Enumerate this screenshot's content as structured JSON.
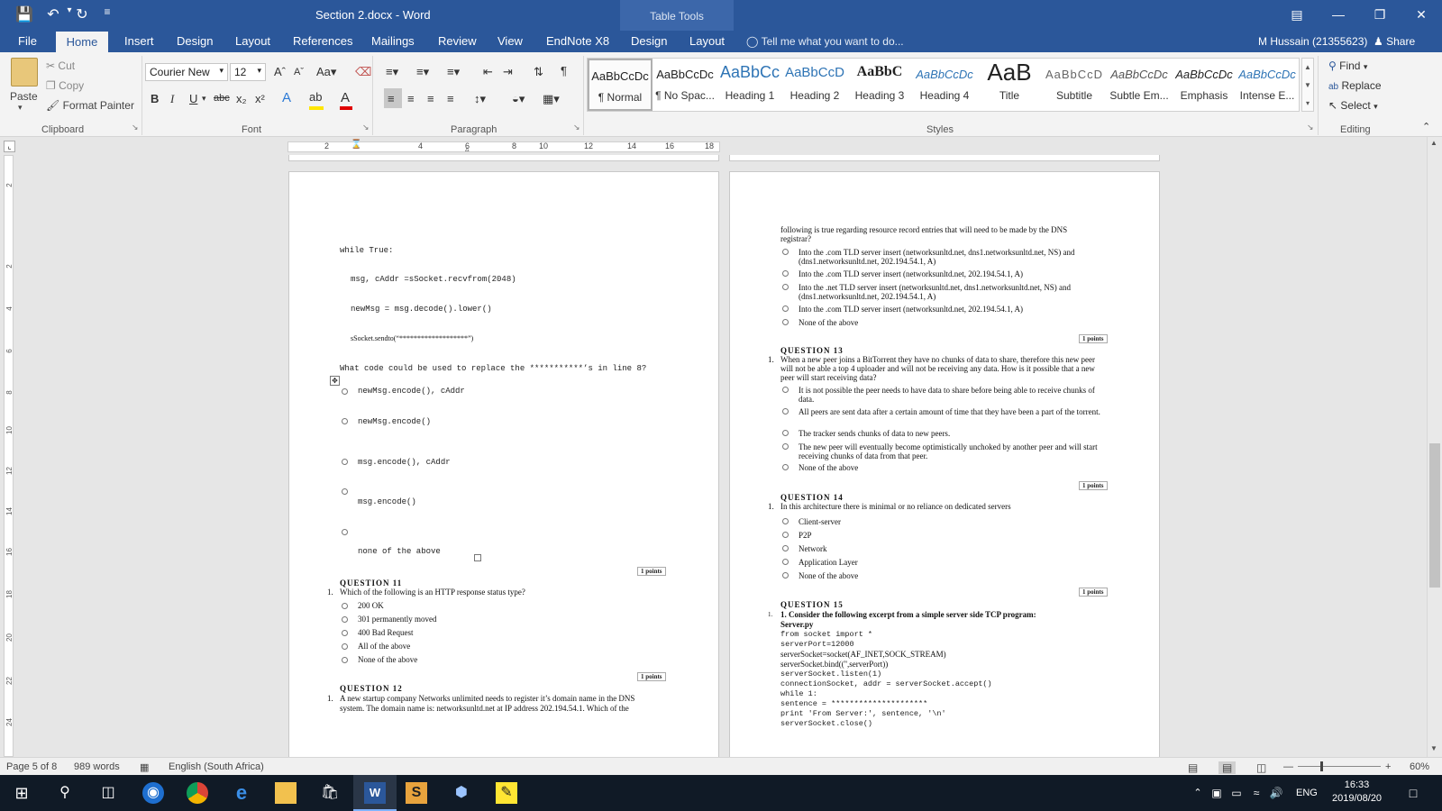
{
  "window": {
    "doc_title": "Section 2.docx - Word",
    "table_tools": "Table Tools"
  },
  "tabs": {
    "file": "File",
    "home": "Home",
    "insert": "Insert",
    "design": "Design",
    "layout": "Layout",
    "references": "References",
    "mailings": "Mailings",
    "review": "Review",
    "view": "View",
    "endnote": "EndNote X8",
    "design2": "Design",
    "layout2": "Layout",
    "tell_me": "Tell me what you want to do...",
    "user": "M Hussain (21355623)",
    "share": "Share"
  },
  "clipboard": {
    "paste": "Paste",
    "cut": "Cut",
    "copy": "Copy",
    "format_painter": "Format Painter",
    "group": "Clipboard"
  },
  "font": {
    "name": "Courier New",
    "size": "12",
    "group": "Font"
  },
  "paragraph": {
    "group": "Paragraph"
  },
  "styles": {
    "group": "Styles",
    "items": [
      {
        "preview": "AaBbCcDc",
        "name": "¶ Normal"
      },
      {
        "preview": "AaBbCcDc",
        "name": "¶ No Spac..."
      },
      {
        "preview": "AaBbCc",
        "name": "Heading 1"
      },
      {
        "preview": "AaBbCcD",
        "name": "Heading 2"
      },
      {
        "preview": "AaBbC",
        "name": "Heading 3"
      },
      {
        "preview": "AaBbCcDc",
        "name": "Heading 4"
      },
      {
        "preview": "AaB",
        "name": "Title"
      },
      {
        "preview": "AaBbCcD",
        "name": "Subtitle"
      },
      {
        "preview": "AaBbCcDc",
        "name": "Subtle Em..."
      },
      {
        "preview": "AaBbCcDc",
        "name": "Emphasis"
      },
      {
        "preview": "AaBbCcDc",
        "name": "Intense E..."
      }
    ]
  },
  "editing": {
    "find": "Find",
    "replace": "Replace",
    "select": "Select",
    "group": "Editing"
  },
  "ruler": {
    "ticks": [
      "2",
      "4",
      "6",
      "8",
      "10",
      "12",
      "14",
      "16",
      "18"
    ]
  },
  "vruler": {
    "ticks": [
      "2",
      "2",
      "4",
      "6",
      "8",
      "10",
      "12",
      "14",
      "16",
      "18",
      "20",
      "22",
      "24"
    ]
  },
  "left_page": {
    "code": {
      "while": "while True:",
      "recv": "msg, cAddr =sSocket.recvfrom(2048)",
      "newmsg": "newMsg = msg.decode().lower()",
      "sendto": "sSocket.sendto(“*******************”)"
    },
    "question": "What code could be used to replace the ***********’s in line 8?",
    "options": [
      "newMsg.encode(), cAddr",
      "newMsg.encode()",
      "msg.encode(), cAddr",
      "msg.encode()",
      "none of the above"
    ],
    "q11": {
      "points": "1 points",
      "title": "QUESTION 11",
      "text": "Which of the following is an HTTP response status type?",
      "options": [
        "200 OK",
        "301 permanently moved",
        "400 Bad Request",
        "All of the above",
        "None of the above"
      ]
    },
    "q12": {
      "points": "1 points",
      "title": "QUESTION 12",
      "line1": "A new startup company Networks unlimited needs to register it’s domain name in the DNS",
      "line2": "system. The domain name is: networksunltd.net at IP address 202.194.54.1. Which of the"
    }
  },
  "right_page": {
    "cont1": "following is true regarding resource record entries that will need to be made by the DNS",
    "cont2": "registrar?",
    "options12": [
      "Into the .com TLD server insert (networksunltd.net, dns1.networksunltd.net, NS) and (dns1.networksunltd.net, 202.194.54.1, A)",
      "Into the .com TLD server insert (networksunltd.net, 202.194.54.1, A)",
      "Into the .net TLD server insert (networksunltd.net, dns1.networksunltd.net, NS) and (dns1.networksunltd.net, 202.194.54.1, A)",
      "Into the .com TLD server insert (networksunltd.net, 202.194.54.1, A)",
      "None of the above"
    ],
    "q13": {
      "points": "1 points",
      "title": "QUESTION 13",
      "text": "When a new peer joins a BitTorrent they have no chunks of data to share, therefore this new peer will not be able a top 4 uploader and will not be receiving any data. How is it possible that a new peer will start receiving data?",
      "options": [
        "It is not possible the peer needs to have data to share before being able to receive chunks of data.",
        "All peers are sent data after a certain amount of time that they have been a part of the torrent.",
        "The tracker sends chunks of data to new peers.",
        "The new peer will eventually become optimistically unchoked by another peer and will start receiving chunks of data from that peer.",
        "None of the above"
      ]
    },
    "q14": {
      "points": "1 points",
      "title": "QUESTION 14",
      "text": "In this architecture there is minimal or no reliance on dedicated servers",
      "options": [
        "Client-server",
        "P2P",
        "Network",
        "Application Layer",
        "None of the above"
      ]
    },
    "q15": {
      "points": "1 points",
      "title": "QUESTION 15",
      "heading": "1.  Consider the following excerpt from a simple server side TCP program:",
      "file": "Server.py",
      "lines": [
        "from socket import *",
        "serverPort=12000",
        "serverSocket=socket(AF_INET,SOCK_STREAM)",
        "serverSocket.bind(('',serverPort))",
        "serverSocket.listen(1)",
        "connectionSocket, addr = serverSocket.accept()",
        "while 1:",
        "sentence = *********************",
        "print 'From Server:', sentence, '\\n'",
        "serverSocket.close()"
      ]
    }
  },
  "status": {
    "page": "Page 5 of 8",
    "words": "989 words",
    "language": "English (South Africa)",
    "zoom": "60%"
  },
  "taskbar": {
    "lang": "ENG",
    "time": "16:33",
    "date": "2019/08/20"
  },
  "colors": {
    "word_blue": "#2b579a",
    "taskbar": "#101a26"
  }
}
